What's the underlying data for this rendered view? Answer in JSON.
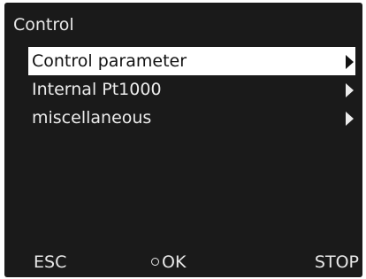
{
  "header": {
    "title": "Control"
  },
  "menu": {
    "items": [
      {
        "label": "Control parameter",
        "selected": true,
        "icon": "arrow-right-icon"
      },
      {
        "label": "Internal Pt1000",
        "selected": false,
        "icon": "arrow-right-icon"
      },
      {
        "label": "miscellaneous",
        "selected": false,
        "icon": "arrow-right-icon"
      }
    ]
  },
  "softkeys": {
    "esc_label": "ESC",
    "ok_label": "OK",
    "ok_icon": "knob-dot-icon",
    "stop_label": "STOP"
  },
  "colors": {
    "background": "#1a1a1a",
    "text": "#e8e8e8",
    "selection": "#ffffff"
  }
}
